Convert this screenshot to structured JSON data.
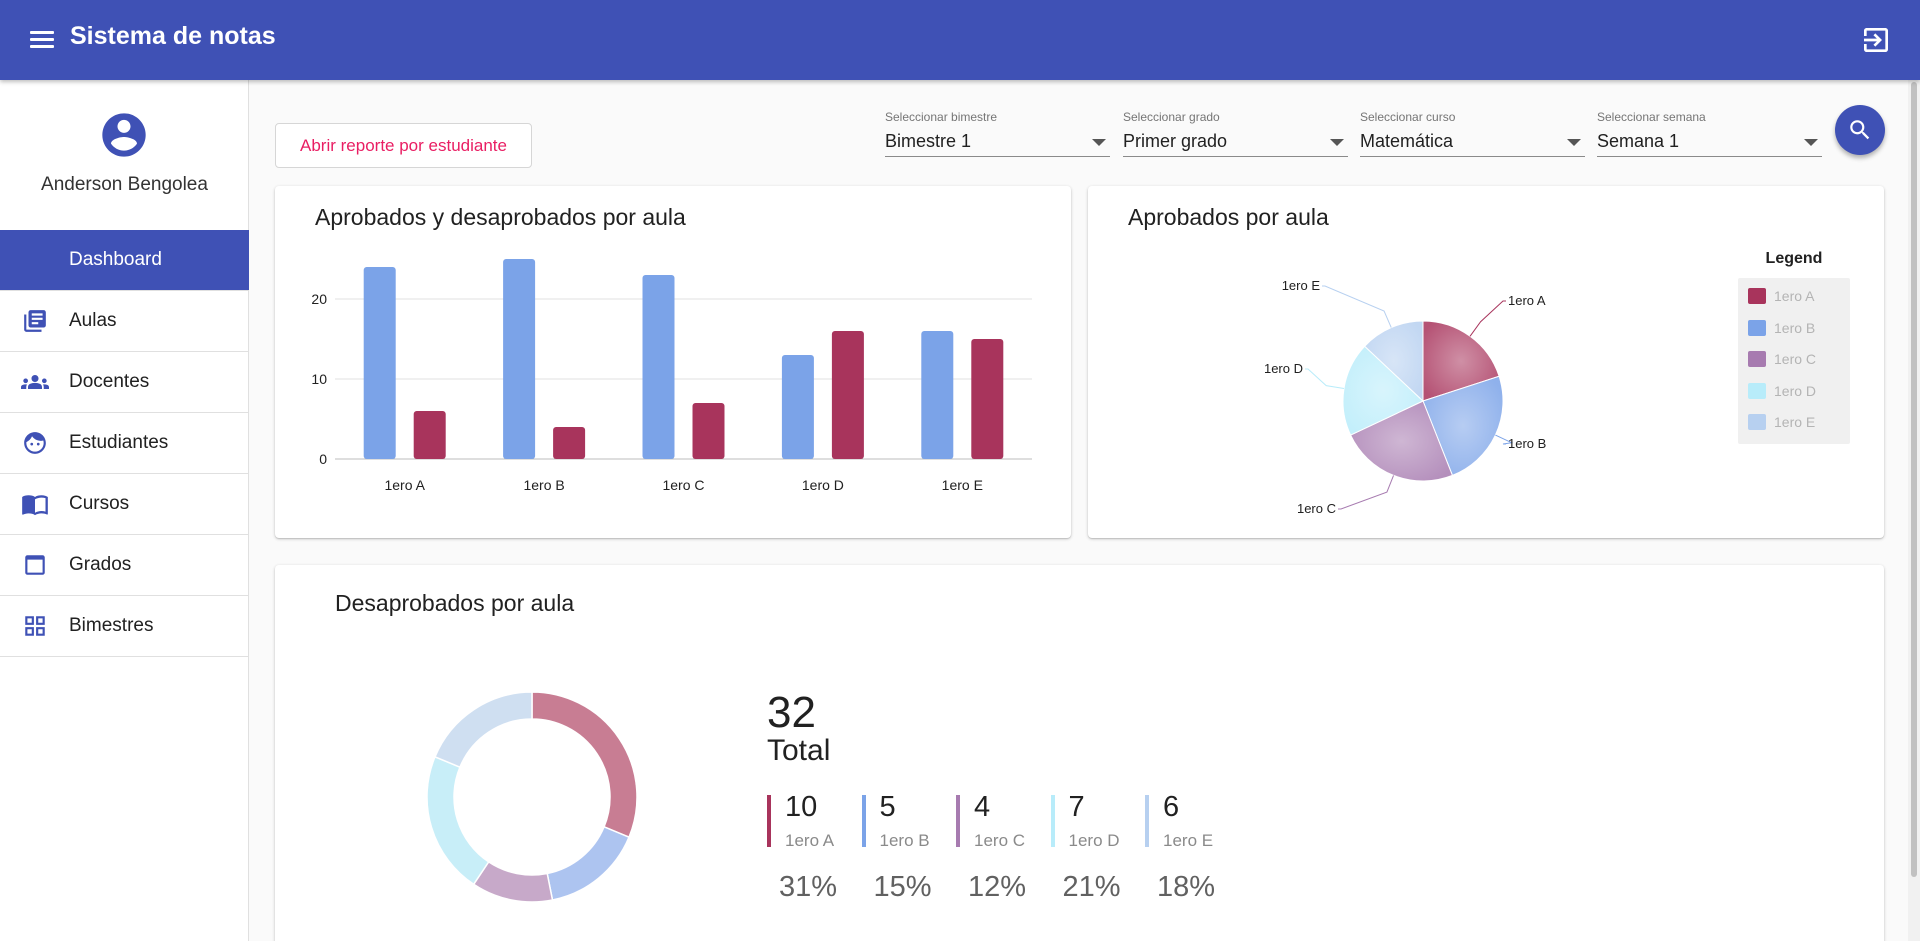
{
  "app": {
    "title": "Sistema de notas"
  },
  "user": {
    "name": "Anderson Bengolea"
  },
  "sidebar": {
    "items": [
      {
        "label": "Dashboard",
        "icon": "dashboard"
      },
      {
        "label": "Aulas",
        "icon": "library-books-icon"
      },
      {
        "label": "Docentes",
        "icon": "people-icon"
      },
      {
        "label": "Estudiantes",
        "icon": "face-icon"
      },
      {
        "label": "Cursos",
        "icon": "book-open-icon"
      },
      {
        "label": "Grados",
        "icon": "crop-square-icon"
      },
      {
        "label": "Bimestres",
        "icon": "grid-icon"
      }
    ]
  },
  "filters": {
    "report_button": "Abrir reporte por estudiante",
    "bimestre": {
      "label": "Seleccionar bimestre",
      "value": "Bimestre 1"
    },
    "grado": {
      "label": "Seleccionar grado",
      "value": "Primer grado"
    },
    "curso": {
      "label": "Seleccionar curso",
      "value": "Matemática"
    },
    "semana": {
      "label": "Seleccionar semana",
      "value": "Semana 1"
    }
  },
  "colors": {
    "primary": "#3f51b5",
    "accent": "#e91e63",
    "approved": "#7ba3e8",
    "failed": "#a8345c",
    "slices": [
      "#a8345c",
      "#7ba3e8",
      "#a77bb0",
      "#b8ecfa",
      "#b7d0f0"
    ]
  },
  "chart_data": [
    {
      "type": "bar",
      "title": "Aprobados y desaprobados por aula",
      "categories": [
        "1ero A",
        "1ero B",
        "1ero C",
        "1ero D",
        "1ero E"
      ],
      "series": [
        {
          "values": [
            24,
            25,
            23,
            13,
            16
          ]
        },
        {
          "values": [
            6,
            4,
            7,
            16,
            15
          ]
        }
      ],
      "yticks": [
        0,
        10,
        20
      ],
      "ylim": [
        0,
        26
      ],
      "grid": true
    },
    {
      "type": "pie",
      "title": "Aprobados por aula",
      "labels": [
        "1ero A",
        "1ero B",
        "1ero C",
        "1ero D",
        "1ero E"
      ],
      "values": [
        20,
        24,
        24,
        19,
        13
      ],
      "legend_title": "Legend",
      "legend_position": "right"
    },
    {
      "type": "pie",
      "title": "Desaprobados por aula",
      "labels": [
        "1ero A",
        "1ero B",
        "1ero C",
        "1ero D",
        "1ero E"
      ],
      "values": [
        10,
        5,
        4,
        7,
        6
      ],
      "percents": [
        "31%",
        "15%",
        "12%",
        "21%",
        "18%"
      ],
      "total": "32",
      "total_label": "Total"
    }
  ]
}
